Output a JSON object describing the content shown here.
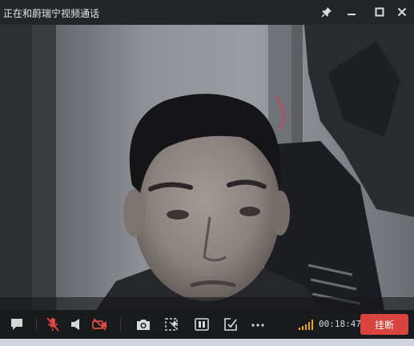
{
  "window": {
    "title": "正在和蔚瑞宁视频通话",
    "controls": [
      "pin-icon",
      "minimize-icon",
      "maximize-icon",
      "close-icon"
    ]
  },
  "toolbar": {
    "buttons": [
      {
        "name": "chat-icon"
      },
      {
        "name": "mic-muted-icon",
        "color": "#e04a44"
      },
      {
        "name": "speaker-icon"
      },
      {
        "name": "camera-off-icon",
        "color": "#e04a44"
      },
      {
        "name": "snapshot-icon"
      },
      {
        "name": "effects-icon"
      },
      {
        "name": "layout-icon"
      },
      {
        "name": "share-icon"
      },
      {
        "name": "more-icon"
      }
    ],
    "signal_icon": "signal-bars-icon",
    "signal_color": "#f2a400",
    "timer": "00:18:47",
    "hangup_label": "挂断",
    "hangup_color": "#d9443f"
  }
}
